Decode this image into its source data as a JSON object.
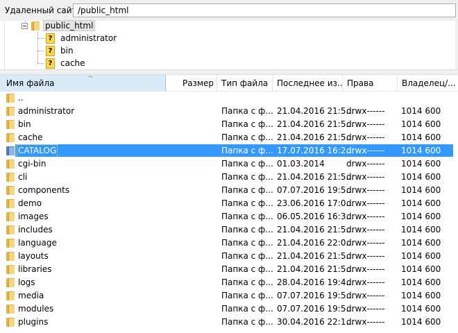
{
  "pathbar": {
    "label": "Удаленный сайт:",
    "path": "/public_html"
  },
  "tree": {
    "root": "public_html",
    "children": [
      "administrator",
      "bin",
      "cache"
    ]
  },
  "columns": {
    "name": "Имя файла",
    "size": "Размер",
    "type": "Тип файла",
    "modified": "Последнее из...",
    "perms": "Права",
    "owner": "Владелец/..."
  },
  "rows": [
    {
      "name": "..",
      "type": "",
      "modified": "",
      "perms": "",
      "owner": ""
    },
    {
      "name": "administrator",
      "type": "Папка с ф...",
      "modified": "21.04.2016 21:5...",
      "perms": "drwx------",
      "owner": "1014 600"
    },
    {
      "name": "bin",
      "type": "Папка с ф...",
      "modified": "21.04.2016 21:5...",
      "perms": "drwx------",
      "owner": "1014 600"
    },
    {
      "name": "cache",
      "type": "Папка с ф...",
      "modified": "21.04.2016 21:5...",
      "perms": "drwx------",
      "owner": "1014 600"
    },
    {
      "name": "CATALOG",
      "type": "Папка с ф...",
      "modified": "17.07.2016 16:2...",
      "perms": "drwx------",
      "owner": "1014 600",
      "selected": true
    },
    {
      "name": "cgi-bin",
      "type": "Папка с ф...",
      "modified": "01.03.2014",
      "perms": "drwx------",
      "owner": "1014 600"
    },
    {
      "name": "cli",
      "type": "Папка с ф...",
      "modified": "21.04.2016 21:5...",
      "perms": "drwx------",
      "owner": "1014 600"
    },
    {
      "name": "components",
      "type": "Папка с ф...",
      "modified": "07.07.2016 19:5...",
      "perms": "drwx------",
      "owner": "1014 600"
    },
    {
      "name": "demo",
      "type": "Папка с ф...",
      "modified": "23.06.2016 17:0...",
      "perms": "drwx------",
      "owner": "1014 600"
    },
    {
      "name": "images",
      "type": "Папка с ф...",
      "modified": "06.05.2016 16:3...",
      "perms": "drwx------",
      "owner": "1014 600"
    },
    {
      "name": "includes",
      "type": "Папка с ф...",
      "modified": "21.04.2016 21:5...",
      "perms": "drwx------",
      "owner": "1014 600"
    },
    {
      "name": "language",
      "type": "Папка с ф...",
      "modified": "21.04.2016 22:0...",
      "perms": "drwx------",
      "owner": "1014 600"
    },
    {
      "name": "layouts",
      "type": "Папка с ф...",
      "modified": "21.04.2016 21:5...",
      "perms": "drwx------",
      "owner": "1014 600"
    },
    {
      "name": "libraries",
      "type": "Папка с ф...",
      "modified": "21.04.2016 21:5...",
      "perms": "drwx------",
      "owner": "1014 600"
    },
    {
      "name": "logs",
      "type": "Папка с ф...",
      "modified": "28.04.2016 19:4...",
      "perms": "drwx------",
      "owner": "1014 600"
    },
    {
      "name": "media",
      "type": "Папка с ф...",
      "modified": "07.07.2016 19:5...",
      "perms": "drwx------",
      "owner": "1014 600"
    },
    {
      "name": "modules",
      "type": "Папка с ф...",
      "modified": "07.07.2016 19:5...",
      "perms": "drwx------",
      "owner": "1014 600"
    },
    {
      "name": "plugins",
      "type": "Папка с ф...",
      "modified": "30.04.2016 22:1...",
      "perms": "drwx------",
      "owner": "1014 600"
    }
  ],
  "icons": {
    "folder": "folder-icon",
    "unknown": "question-icon",
    "collapse": "collapse-icon"
  },
  "colors": {
    "selection": "#3399ff",
    "header_active": "#d9ebf9",
    "folder": "#f6d77d"
  }
}
